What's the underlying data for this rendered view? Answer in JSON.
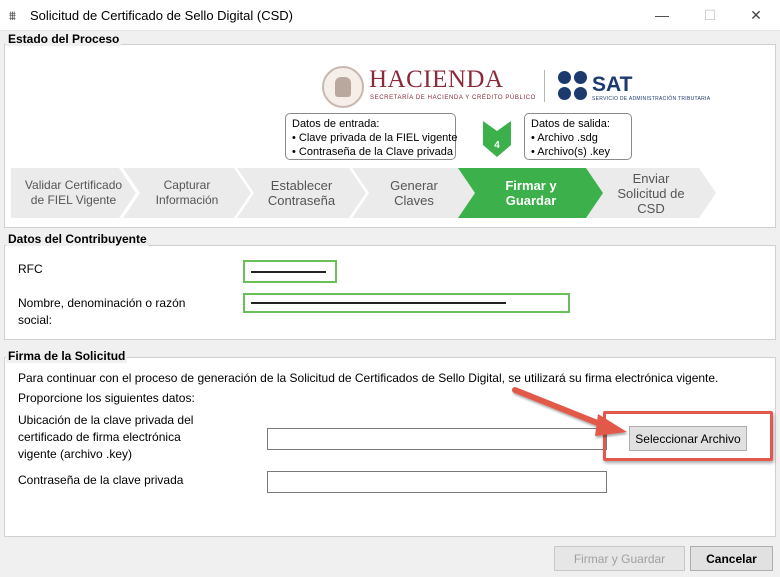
{
  "window": {
    "title": "Solicitud de Certificado de Sello Digital (CSD)",
    "app_icon": "app-icon",
    "minimize_glyph": "—",
    "maximize_glyph": "☐",
    "close_glyph": "✕"
  },
  "process": {
    "group_label": "Estado del Proceso",
    "hacienda_title": "HACIENDA",
    "hacienda_subtitle": "SECRETARÍA DE HACIENDA Y CRÉDITO PÚBLICO",
    "sat_title": "SAT",
    "sat_subtitle": "SERVICIO DE ADMINISTRACIÓN TRIBUTARIA",
    "input_box": {
      "title": "Datos de entrada:",
      "items": [
        "• Clave privada de la FIEL vigente",
        "• Contraseña de la Clave privada"
      ]
    },
    "output_box": {
      "title": "Datos de salida:",
      "items": [
        "• Archivo .sdg",
        "• Archivo(s) .key"
      ]
    },
    "current_step_number": "4",
    "steps": [
      {
        "label": "Validar Certificado\nde FIEL Vigente",
        "state": "done"
      },
      {
        "label": "Capturar\nInformación",
        "state": "done"
      },
      {
        "label": "Establecer\nContraseña",
        "state": "done"
      },
      {
        "label": "Generar\nClaves",
        "state": "done"
      },
      {
        "label": "Firmar y\nGuardar",
        "state": "active"
      },
      {
        "label": "Enviar\nSolicitud de\nCSD",
        "state": "pending"
      }
    ],
    "colors": {
      "active_step": "#3cb04a",
      "inactive_step": "#ebebeb",
      "hacienda": "#8a2a3a",
      "sat": "#1c3a6e"
    }
  },
  "taxpayer": {
    "group_label": "Datos del Contribuyente",
    "rfc_label": "RFC",
    "name_label": "Nombre, denominación o razón\nsocial:",
    "field_border_color": "#6abf5b"
  },
  "signature": {
    "group_label": "Firma de la Solicitud",
    "intro_text": "Para continuar con el proceso de generación de la Solicitud de Certificados de Sello Digital, se utilizará su firma electrónica vigente.",
    "prompt_text": "Proporcione los siguientes datos:",
    "key_location_label": "Ubicación de la clave privada del\ncertificado de firma electrónica\nvigente (archivo .key)",
    "key_location_value": "",
    "select_file_button": "Seleccionar Archivo",
    "password_label": "Contraseña de la clave privada",
    "password_value": "",
    "highlight_color": "#e2584a"
  },
  "footer": {
    "sign_save_button": "Firmar y Guardar",
    "cancel_button": "Cancelar"
  }
}
